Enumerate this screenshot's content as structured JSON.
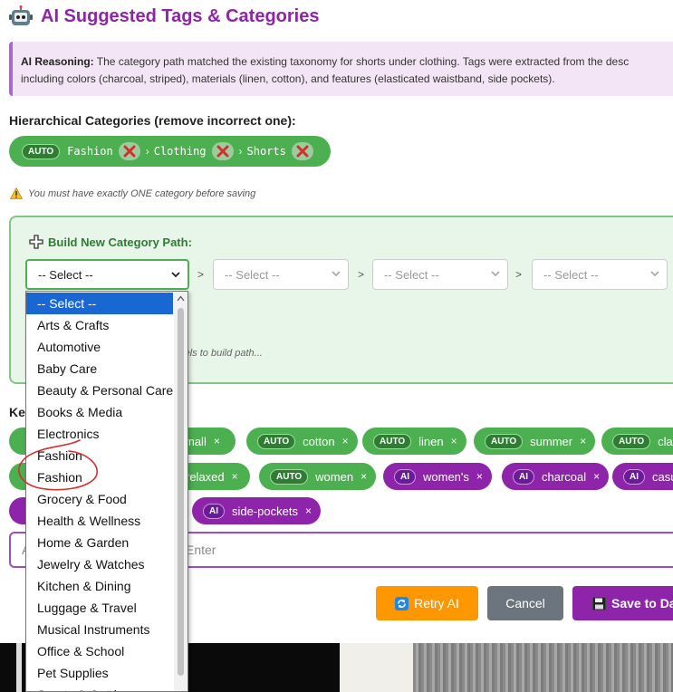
{
  "header": {
    "title": "AI Suggested Tags & Categories"
  },
  "reasoning": {
    "label": "AI Reasoning:",
    "line1": "The category path matched the existing taxonomy for shorts under clothing. Tags were extracted from the desc",
    "line2": "including colors (charcoal, striped), materials (linen, cotton), and features (elasticated waistband, side pockets)."
  },
  "categories": {
    "heading": "Hierarchical Categories (remove incorrect one):",
    "badge": "AUTO",
    "path": [
      "Fashion",
      "Clothing",
      "Shorts"
    ],
    "separator": "›",
    "warning": "You must have exactly ONE category before saving"
  },
  "builder": {
    "title": "Build New Category Path:",
    "selects": [
      "-- Select --",
      "-- Select --",
      "-- Select --",
      "-- Select --"
    ],
    "arrow": ">",
    "hint": "evels to build path..."
  },
  "keywords": {
    "label": "Key",
    "chips": [
      {
        "type": "AUTO",
        "text": "mall"
      },
      {
        "type": "AUTO",
        "text": "cotton"
      },
      {
        "type": "AUTO",
        "text": "linen"
      },
      {
        "type": "AUTO",
        "text": "summer"
      },
      {
        "type": "AUTO",
        "text": "clas"
      },
      {
        "type": "AUTO",
        "text": "relaxed"
      },
      {
        "type": "AUTO",
        "text": "women"
      },
      {
        "type": "AI",
        "text": "women's"
      },
      {
        "type": "AI",
        "text": "charcoal"
      },
      {
        "type": "AI",
        "text": "casu"
      },
      {
        "type": "AI",
        "text": "side-pockets"
      }
    ],
    "remove_glyph": "×",
    "input_placeholder_fragment": "A",
    "input_hint_fragment": "Enter"
  },
  "buttons": {
    "retry": "Retry AI",
    "cancel": "Cancel",
    "save": "Save to Da"
  },
  "dropdown": {
    "options": [
      "-- Select --",
      "Arts & Crafts",
      "Automotive",
      "Baby Care",
      "Beauty & Personal Care",
      "Books & Media",
      "Electronics",
      "Fashion",
      "Fashion",
      "Grocery & Food",
      "Health & Wellness",
      "Home & Garden",
      "Jewelry & Watches",
      "Kitchen & Dining",
      "Luggage & Travel",
      "Musical Instruments",
      "Office & School",
      "Pet Supplies",
      "Sports & Outdoors"
    ],
    "selected_index": 0
  },
  "colors": {
    "brand_purple": "#8e24aa",
    "auto_green": "#4caf50",
    "retry_orange": "#ff9800",
    "cancel_gray": "#6c757d",
    "selected_blue": "#1967d2",
    "annotation_red": "#d32f2f"
  }
}
